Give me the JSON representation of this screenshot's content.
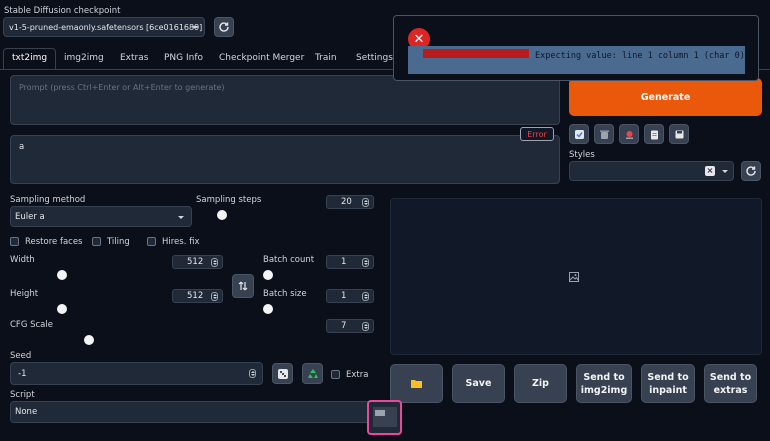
{
  "checkpoint": {
    "label": "Stable Diffusion checkpoint",
    "value": "v1-5-pruned-emaonly.safetensors [6ce0161689]"
  },
  "tabs": [
    {
      "label": "txt2img",
      "active": true
    },
    {
      "label": "img2img"
    },
    {
      "label": "Extras"
    },
    {
      "label": "PNG Info"
    },
    {
      "label": "Checkpoint Merger"
    },
    {
      "label": "Train"
    },
    {
      "label": "Settings"
    }
  ],
  "prompt": {
    "placeholder": "Prompt (press Ctrl+Enter or Alt+Enter to generate)"
  },
  "negative_prompt": {
    "value": "a"
  },
  "error_badge": "Error",
  "generate_label": "Generate",
  "styles_label": "Styles",
  "sampling": {
    "method_label": "Sampling method",
    "method_value": "Euler a",
    "steps_label": "Sampling steps",
    "steps_value": "20",
    "steps_fraction": 0.13
  },
  "options": {
    "restore_faces": "Restore faces",
    "tiling": "Tiling",
    "hires_fix": "Hires. fix"
  },
  "width": {
    "label": "Width",
    "value": "512",
    "fraction": 0.25
  },
  "height": {
    "label": "Height",
    "value": "512",
    "fraction": 0.25
  },
  "batch_count": {
    "label": "Batch count",
    "value": "1"
  },
  "batch_size": {
    "label": "Batch size",
    "value": "1"
  },
  "cfg": {
    "label": "CFG Scale",
    "value": "7",
    "fraction": 0.2
  },
  "seed": {
    "label": "Seed",
    "value": "-1",
    "extra_label": "Extra"
  },
  "script": {
    "label": "Script",
    "value": "None"
  },
  "actions": {
    "save": "Save",
    "zip": "Zip",
    "send_img2img": "Send to img2img",
    "send_inpaint": "Send to inpaint",
    "send_extras": "Send to extras"
  },
  "error_toast": {
    "message": "Expecting value: line 1 column 1 (char 0)"
  },
  "colors": {
    "accent": "#ea580c",
    "error": "#dc2626"
  }
}
